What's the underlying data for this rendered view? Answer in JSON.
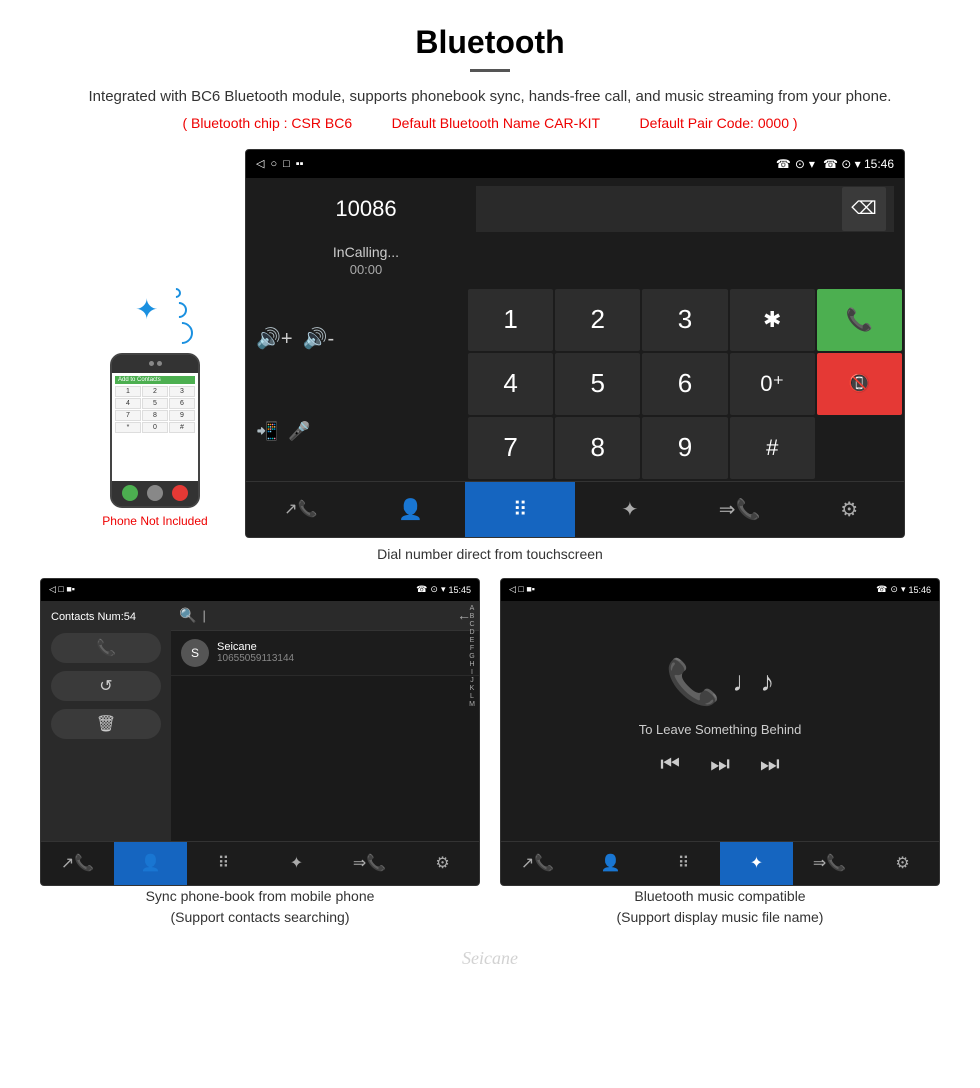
{
  "header": {
    "title": "Bluetooth",
    "description": "Integrated with BC6 Bluetooth module, supports phonebook sync, hands-free call, and music streaming from your phone.",
    "specs": {
      "chip": "( Bluetooth chip : CSR BC6",
      "name": "Default Bluetooth Name CAR-KIT",
      "pair": "Default Pair Code: 0000 )"
    }
  },
  "dial_screen": {
    "status_bar": {
      "left_icons": "◁  □  □  ■▪",
      "right_icons": "☎  ⊙  ▾  15:46"
    },
    "display": {
      "number": "10086",
      "calling_text": "InCalling...",
      "timer": "00:00"
    },
    "keypad": {
      "keys": [
        "1",
        "2",
        "3",
        "*",
        "4",
        "5",
        "6",
        "0+",
        "7",
        "8",
        "9",
        "#"
      ],
      "call_green": "📞",
      "call_red": "📞"
    },
    "bottom_nav": {
      "items": [
        "↗☎",
        "👤",
        "⠿",
        "❋",
        "⇒☎",
        "⚙"
      ]
    },
    "caption": "Dial number direct from touchscreen"
  },
  "phone_mockup": {
    "label": "Phone Not Included",
    "screen_header": "Add to Contacts",
    "keys": [
      "1",
      "2",
      "3",
      "4",
      "5",
      "6",
      "7",
      "8",
      "9",
      "*",
      "0",
      "#"
    ]
  },
  "contacts_screen": {
    "status_bar": {
      "left": "◁  □  ■▪",
      "right": "☎  ⊙  ▾  15:45"
    },
    "sidebar": {
      "contacts_num": "Contacts Num:54",
      "buttons": [
        "☎",
        "↺",
        "🗑"
      ]
    },
    "search": {
      "placeholder": "|",
      "back": "←"
    },
    "contact": {
      "name": "Seicane",
      "number": "10655059113144"
    },
    "alphabet": [
      "A",
      "B",
      "C",
      "D",
      "E",
      "F",
      "G",
      "H",
      "I",
      "J",
      "K",
      "L",
      "M"
    ],
    "bottom_nav": {
      "items": [
        "↗☎",
        "👤",
        "⠿",
        "❋",
        "⇒☎",
        "⚙"
      ],
      "active": 1
    },
    "caption_line1": "Sync phone-book from mobile phone",
    "caption_line2": "(Support contacts searching)"
  },
  "music_screen": {
    "status_bar": {
      "left": "◁  □  ■▪",
      "right": "☎  ⊙  ▾  15:46"
    },
    "track_name": "To Leave Something Behind",
    "controls": [
      "⏮",
      "⏭",
      "⏭"
    ],
    "bottom_nav": {
      "items": [
        "↗☎",
        "👤",
        "⠿",
        "❋",
        "⇒☎",
        "⚙"
      ],
      "active": 3
    },
    "caption_line1": "Bluetooth music compatible",
    "caption_line2": "(Support display music file name)"
  },
  "watermark": "Seicane"
}
